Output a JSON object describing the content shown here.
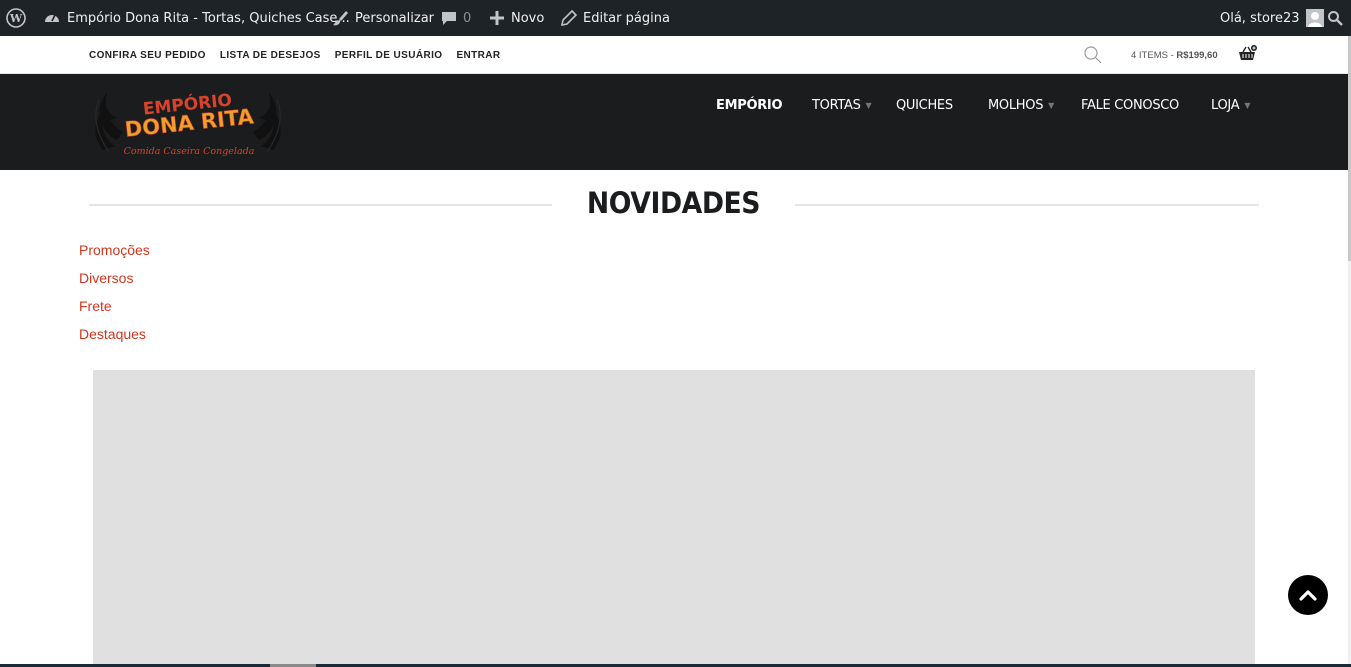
{
  "adminbar": {
    "site_name": "Empório Dona Rita - Tortas, Quiches Case...",
    "customize": "Personalizar",
    "comments_count": "0",
    "new": "Novo",
    "edit_page": "Editar página",
    "greeting": "Olá, store23"
  },
  "topbar": {
    "links": [
      "CONFIRA SEU PEDIDO",
      "LISTA DE DESEJOS",
      "PERFIL DE USUÁRIO",
      "ENTRAR"
    ],
    "cart_items": "4 ITEMS",
    "cart_separator": " - ",
    "cart_total": "R$199,60"
  },
  "logo": {
    "line1": "EMPÓRIO",
    "line2": "DONA RITA",
    "tagline": "Comida Caseira Congelada"
  },
  "nav": {
    "items": [
      {
        "label": "EMPÓRIO"
      },
      {
        "label": "TORTAS"
      },
      {
        "label": "QUICHES"
      },
      {
        "label": "MOLHOS"
      },
      {
        "label": "FALE CONOSCO"
      },
      {
        "label": "LOJA"
      }
    ]
  },
  "content": {
    "title": "NOVIDADES",
    "categories": [
      "Promoções",
      "Diversos",
      "Frete",
      "Destaques"
    ]
  },
  "colors": {
    "adminbar": "#1d2327",
    "header": "#1b1c1d",
    "link_red": "#d1351f",
    "placeholder": "#e0e0e0"
  }
}
